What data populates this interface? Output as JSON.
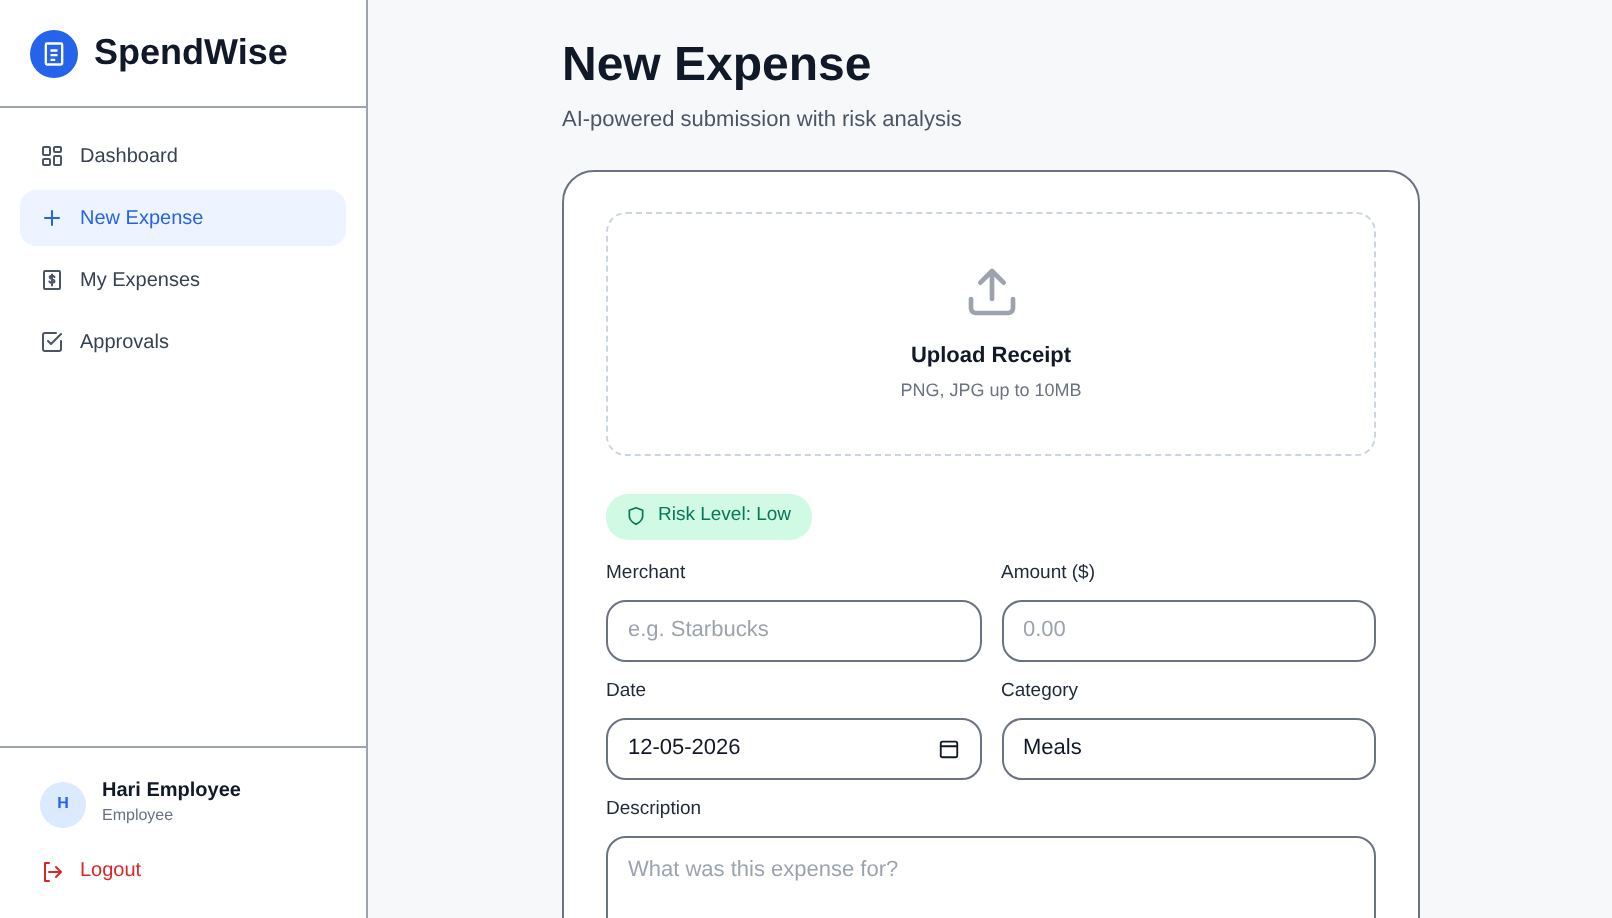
{
  "sidebar": {
    "brand": "SpendWise",
    "items": [
      {
        "label": "Dashboard",
        "selected": false
      },
      {
        "label": "New Expense",
        "selected": true
      },
      {
        "label": "My Expenses",
        "selected": false
      },
      {
        "label": "Approvals",
        "selected": false
      }
    ],
    "user": {
      "initial": "H",
      "name": "Hari Employee",
      "role": "Employee"
    },
    "logout": "Logout"
  },
  "page": {
    "title": "New Expense",
    "subtitle": "AI-powered submission with risk analysis"
  },
  "upload": {
    "title": "Upload Receipt",
    "hint": "PNG, JPG up to 10MB"
  },
  "risk_badge": "Risk Level: Low",
  "fields": [
    {
      "kind": "text",
      "label": "Merchant",
      "placeholder": "e.g. Starbucks"
    },
    {
      "kind": "text",
      "label": "Amount ($)",
      "placeholder": "0.00"
    },
    {
      "kind": "date",
      "label": "Date",
      "value": "12-05-2026"
    },
    {
      "kind": "select",
      "label": "Category",
      "value": "Meals"
    },
    {
      "kind": "textarea",
      "label": "Description",
      "placeholder": "What was this expense for?"
    }
  ]
}
